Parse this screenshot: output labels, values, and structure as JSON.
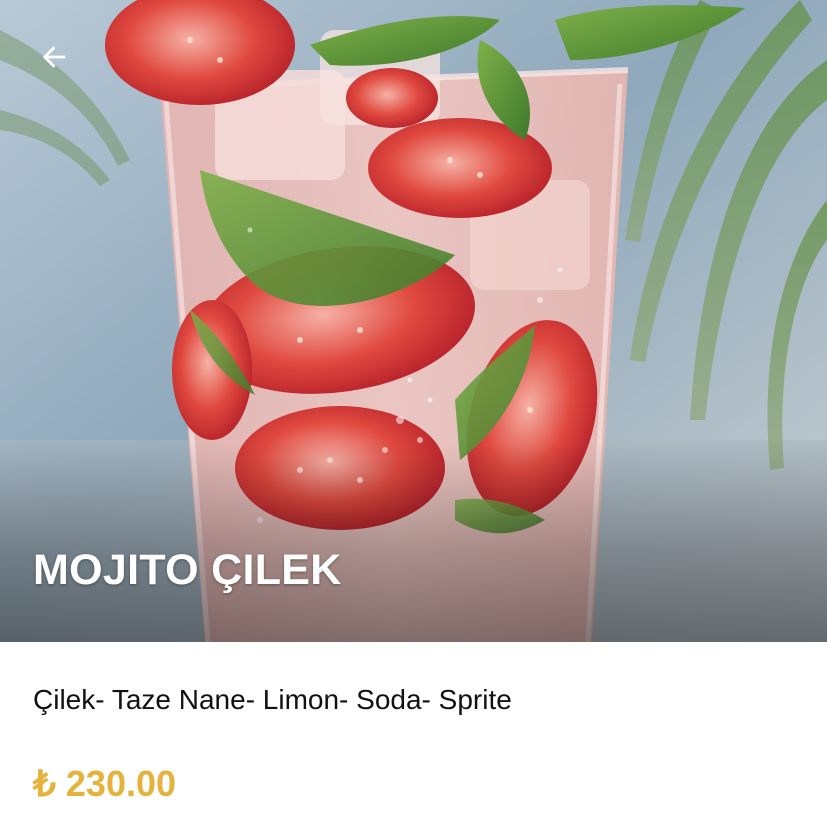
{
  "product": {
    "name": "MOJITO ÇILEK",
    "ingredients": "Çilek- Taze Nane- Limon- Soda- Sprite",
    "price": "₺ 230.00"
  },
  "header": {
    "back_icon": "arrow-left-icon"
  },
  "colors": {
    "price": "#e6b23a",
    "title_text": "#ffffff",
    "back_icon": "#ffffff"
  }
}
